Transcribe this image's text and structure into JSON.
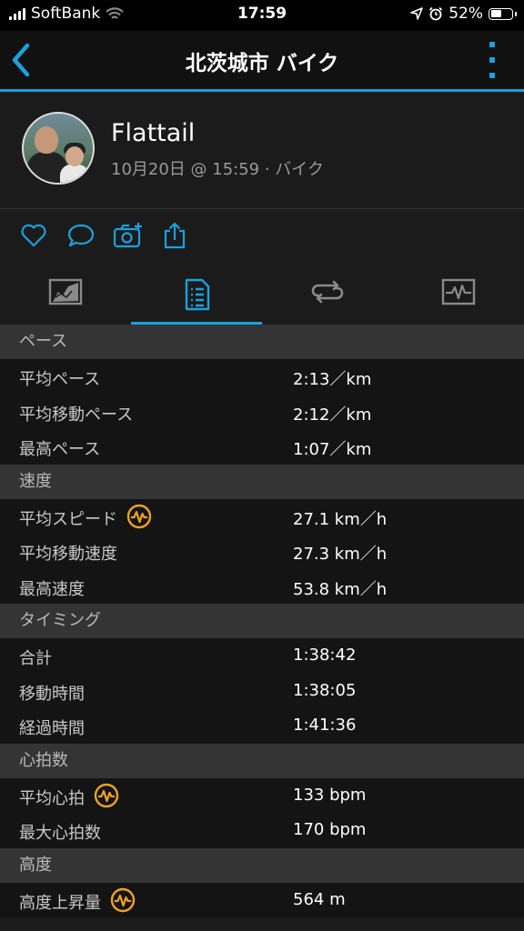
{
  "status_bar": {
    "carrier": "SoftBank",
    "time": "17:59",
    "battery": "52%",
    "battery_level": 0.52
  },
  "nav": {
    "title": "北茨城市 バイク"
  },
  "profile": {
    "name": "Flattail",
    "meta": "10月20日 @ 15:59 · バイク"
  },
  "colors": {
    "accent": "#1aa1de",
    "hr_badge": "#f0a224"
  },
  "sections": [
    {
      "title": "ペース",
      "rows": [
        {
          "label": "平均ペース",
          "value": "2:13／km",
          "icon": false
        },
        {
          "label": "平均移動ペース",
          "value": "2:12／km",
          "icon": false
        },
        {
          "label": "最高ペース",
          "value": "1:07／km",
          "icon": false
        }
      ]
    },
    {
      "title": "速度",
      "rows": [
        {
          "label": "平均スピード",
          "value": "27.1 km／h",
          "icon": true
        },
        {
          "label": "平均移動速度",
          "value": "27.3 km／h",
          "icon": false
        },
        {
          "label": "最高速度",
          "value": "53.8 km／h",
          "icon": false
        }
      ]
    },
    {
      "title": "タイミング",
      "rows": [
        {
          "label": "合計",
          "value": "1:38:42",
          "icon": false
        },
        {
          "label": "移動時間",
          "value": "1:38:05",
          "icon": false
        },
        {
          "label": "経過時間",
          "value": "1:41:36",
          "icon": false
        }
      ]
    },
    {
      "title": "心拍数",
      "rows": [
        {
          "label": "平均心拍",
          "value": "133 bpm",
          "icon": true
        },
        {
          "label": "最大心拍数",
          "value": "170 bpm",
          "icon": false
        }
      ]
    },
    {
      "title": "高度",
      "rows": [
        {
          "label": "高度上昇量",
          "value": "564 m",
          "icon": true
        }
      ]
    }
  ]
}
